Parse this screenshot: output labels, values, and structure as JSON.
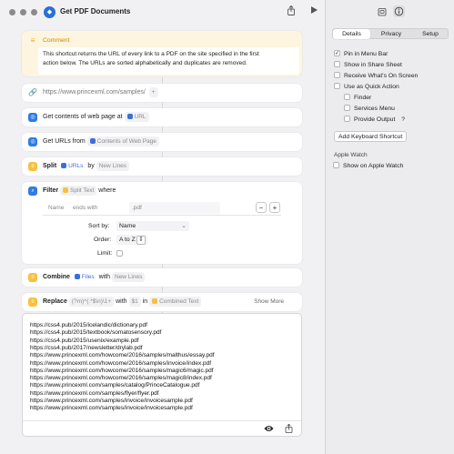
{
  "window": {
    "title": "Get PDF Documents"
  },
  "comment": {
    "label": "Comment",
    "text_line1": "This shortcut returns the URL of every link to a PDF on the site specified in the first",
    "text_line2": "action below. The URLs are sorted alphabetically and duplicates are removed."
  },
  "url_action": {
    "value": "https://www.princexml.com/samples/",
    "add": "+"
  },
  "get_contents": {
    "label": "Get contents of web page at",
    "var": "URL"
  },
  "get_urls": {
    "label": "Get URLs from",
    "var": "Contents of Web Page"
  },
  "split": {
    "label": "Split",
    "var": "URLs",
    "by": "by",
    "value": "New Lines"
  },
  "filter": {
    "label": "Filter",
    "var": "Split Text",
    "where": "where",
    "cond_field": "Name",
    "cond_op": "ends with",
    "cond_value": ".pdf",
    "minus": "−",
    "plus": "+",
    "sort_label": "Sort by:",
    "sort_value": "Name",
    "order_label": "Order:",
    "order_value": "A to Z",
    "limit_label": "Limit:"
  },
  "combine": {
    "label": "Combine",
    "var": "Files",
    "with": "with",
    "value": "New Lines"
  },
  "replace": {
    "label": "Replace",
    "pattern": "(?m)^(.*$\\n)\\1+",
    "with": "with",
    "replacement": "$1",
    "in": "in",
    "var": "Combined Text",
    "show_more": "Show More"
  },
  "output": {
    "lines": [
      "https://css4.pub/2015/icelandic/dictionary.pdf",
      "https://css4.pub/2015/textbook/somatosensory.pdf",
      "https://css4.pub/2015/usenix/example.pdf",
      "https://css4.pub/2017/newsletter/drylab.pdf",
      "https://www.princexml.com/howcome/2016/samples/malthus/essay.pdf",
      "https://www.princexml.com/howcome/2016/samples/invoice/index.pdf",
      "https://www.princexml.com/howcome/2016/samples/magic6/magic.pdf",
      "https://www.princexml.com/howcome/2016/samples/magic8/index.pdf",
      "https://www.princexml.com/samples/catalog/PrinceCatalogue.pdf",
      "https://www.princexml.com/samples/flyer/flyer.pdf",
      "https://www.princexml.com/samples/invoice/invoicesample.pdf",
      "https://www.princexml.com/samples/invoice/invoicesample.pdf"
    ]
  },
  "details": {
    "tabs": [
      "Details",
      "Privacy",
      "Setup"
    ],
    "options": [
      {
        "label": "Pin in Menu Bar",
        "checked": true
      },
      {
        "label": "Show in Share Sheet",
        "checked": false
      },
      {
        "label": "Receive What's On Screen",
        "checked": false
      },
      {
        "label": "Use as Quick Action",
        "checked": false
      },
      {
        "label": "Finder",
        "checked": false
      },
      {
        "label": "Services Menu",
        "checked": false
      },
      {
        "label": "Provide Output",
        "checked": false
      }
    ],
    "help": "?",
    "shortcut_button": "Add Keyboard Shortcut",
    "apple_watch_label": "Apple Watch",
    "apple_watch_option": "Show on Apple Watch"
  },
  "colors": {
    "accent": "#2a6fd6",
    "yellow": "#f6c142",
    "comment_bg": "#fdf5df"
  },
  "icons": [
    "shortcut-app-icon",
    "share-icon",
    "play-icon",
    "library-icon",
    "info-icon",
    "link-icon",
    "safari-icon",
    "filter-icon",
    "text-icon",
    "eye-icon"
  ]
}
